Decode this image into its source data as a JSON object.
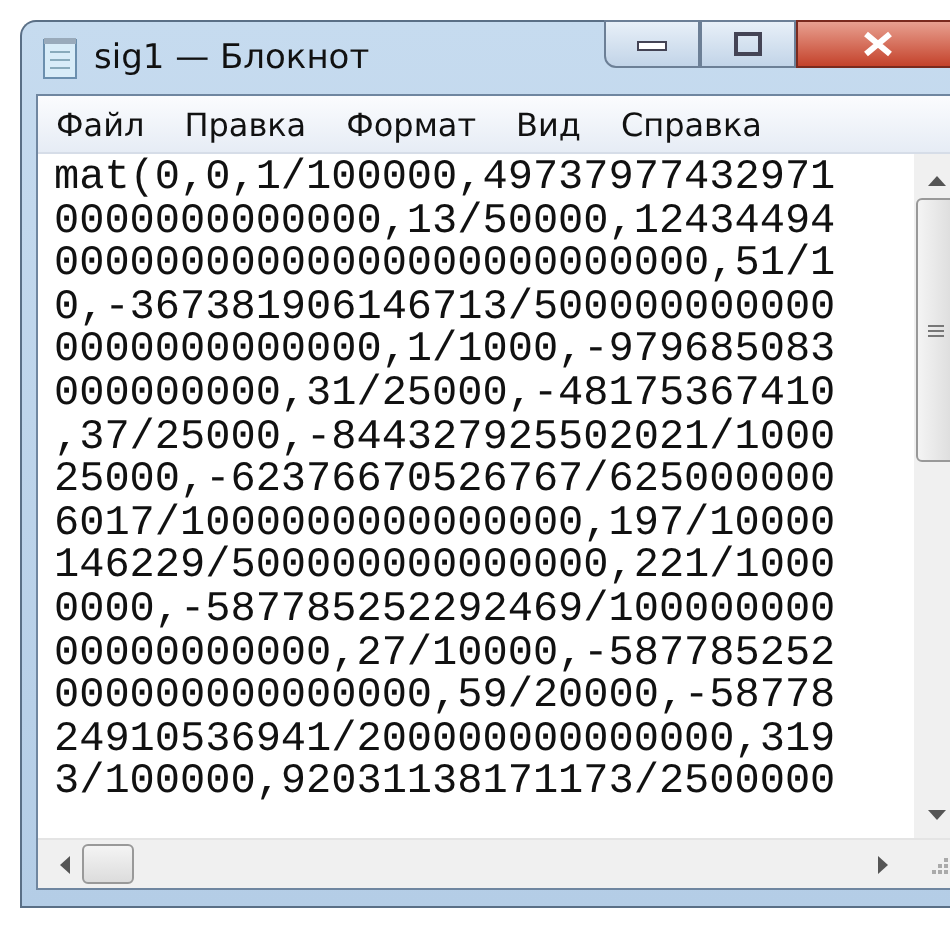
{
  "window": {
    "title": "sig1 — Блокнот"
  },
  "menu": [
    "Файл",
    "Правка",
    "Формат",
    "Вид",
    "Справка"
  ],
  "text_lines": [
    "mat(0,0,1/100000,49737977432971",
    "0000000000000,13/50000,12434494",
    "00000000000000000000000000,51/1",
    "0,-367381906146713/500000000000",
    "0000000000000,1/1000,-979685083",
    "000000000,31/25000,-48175367410",
    ",37/25000,-844327925502021/1000",
    "25000,-62376670526767/625000000",
    "6017/1000000000000000,197/10000",
    "146229/500000000000000,221/1000",
    "0000,-587785252292469/100000000",
    "00000000000,27/10000,-587785252",
    "000000000000000,59/20000,-58778",
    "24910536941/200000000000000,319",
    "3/100000,92031138171173/2500000"
  ]
}
